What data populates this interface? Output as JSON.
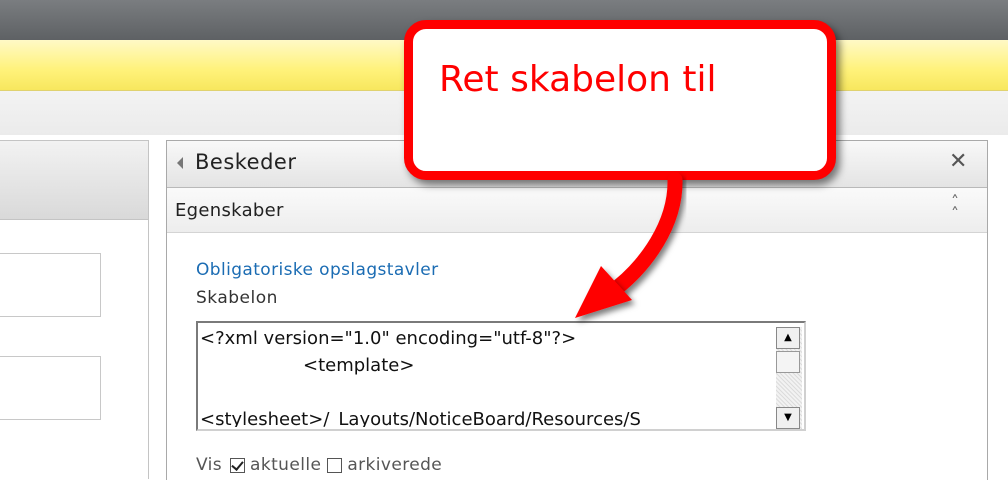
{
  "callout": {
    "text": "Ret skabelon til",
    "color": "#ff0000"
  },
  "pane": {
    "title": "Beskeder",
    "section_title": "Egenskaber",
    "group_link": "Obligatoriske opslagstavler",
    "field_label": "Skabelon",
    "textarea_lines": [
      "<?xml version=\"1.0\" encoding=\"utf-8\"?>",
      "                  <template>",
      "",
      "<stylesheet>/_Layouts/NoticeBoard/Resources/S"
    ],
    "vis_label": "Vis",
    "option_current": "aktuelle",
    "option_current_checked": true,
    "option_archived": "arkiverede",
    "option_archived_checked": false
  },
  "icons": {
    "back": "triangle-left-icon",
    "close": "close-icon",
    "collapse": "double-chevron-up-icon",
    "scroll_up": "arrow-up-icon",
    "scroll_down": "arrow-down-icon"
  }
}
